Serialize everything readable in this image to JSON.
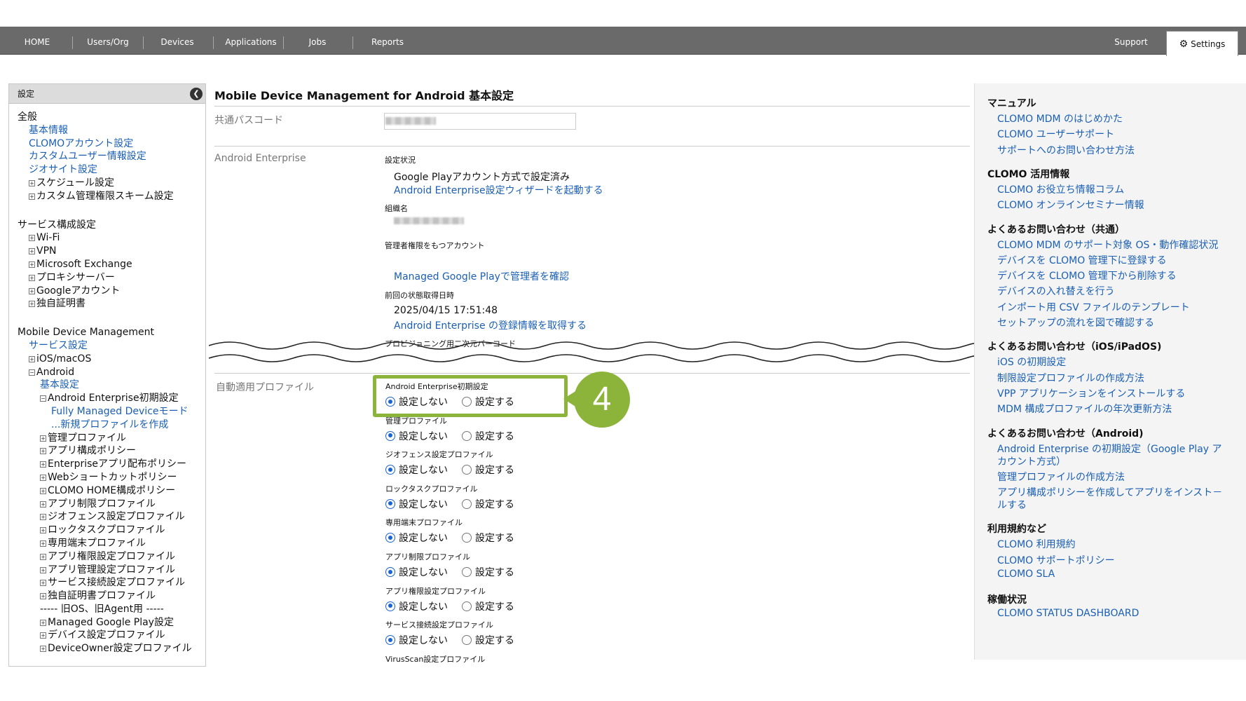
{
  "nav": {
    "items": [
      "HOME",
      "Users/Org",
      "Devices",
      "Applications",
      "Jobs",
      "Reports"
    ],
    "support": "Support",
    "settings": "Settings"
  },
  "sidebar": {
    "title": "設定",
    "rows": [
      {
        "text": "全般",
        "kind": "h"
      },
      {
        "text": "基本情報",
        "kind": "l2link"
      },
      {
        "text": "CLOMOアカウント設定",
        "kind": "l2link"
      },
      {
        "text": "カスタムユーザー情報設定",
        "kind": "l2link"
      },
      {
        "text": "ジオサイト設定",
        "kind": "l2link"
      },
      {
        "text": "スケジュール設定",
        "kind": "l2plus"
      },
      {
        "text": "カスタム管理権限スキーム設定",
        "kind": "l2plus"
      },
      {
        "text": "",
        "kind": "gap"
      },
      {
        "text": "サービス構成設定",
        "kind": "h"
      },
      {
        "text": "Wi-Fi",
        "kind": "l2plus"
      },
      {
        "text": "VPN",
        "kind": "l2plus"
      },
      {
        "text": "Microsoft Exchange",
        "kind": "l2plus"
      },
      {
        "text": "プロキシサーバー",
        "kind": "l2plus"
      },
      {
        "text": "Googleアカウント",
        "kind": "l2plus"
      },
      {
        "text": "独自証明書",
        "kind": "l2plus"
      },
      {
        "text": "",
        "kind": "gap"
      },
      {
        "text": "Mobile Device Management",
        "kind": "h"
      },
      {
        "text": "サービス設定",
        "kind": "l2link"
      },
      {
        "text": "iOS/macOS",
        "kind": "l2plus"
      },
      {
        "text": "Android",
        "kind": "l2minus"
      },
      {
        "text": "基本設定",
        "kind": "l3link"
      },
      {
        "text": "Android Enterprise初期設定",
        "kind": "l3minus"
      },
      {
        "text": "Fully Managed Deviceモード",
        "kind": "l4link"
      },
      {
        "text": "...新規プロファイルを作成",
        "kind": "l4link"
      },
      {
        "text": "管理プロファイル",
        "kind": "l3plus"
      },
      {
        "text": "アプリ構成ポリシー",
        "kind": "l3plus"
      },
      {
        "text": "Enterpriseアプリ配布ポリシー",
        "kind": "l3plus"
      },
      {
        "text": "Webショートカットポリシー",
        "kind": "l3plus"
      },
      {
        "text": "CLOMO HOME構成ポリシー",
        "kind": "l3plus"
      },
      {
        "text": "アプリ制限プロファイル",
        "kind": "l3plus"
      },
      {
        "text": "ジオフェンス設定プロファイル",
        "kind": "l3plus"
      },
      {
        "text": "ロックタスクプロファイル",
        "kind": "l3plus"
      },
      {
        "text": "専用端末プロファイル",
        "kind": "l3plus"
      },
      {
        "text": "アプリ権限設定プロファイル",
        "kind": "l3plus"
      },
      {
        "text": "アプリ管理設定プロファイル",
        "kind": "l3plus"
      },
      {
        "text": "サービス接続設定プロファイル",
        "kind": "l3plus"
      },
      {
        "text": "独自証明書プロファイル",
        "kind": "l3plus"
      },
      {
        "text": "----- 旧OS、旧Agent用 -----",
        "kind": "l3text"
      },
      {
        "text": "Managed Google Play設定",
        "kind": "l3plus"
      },
      {
        "text": "デバイス設定プロファイル",
        "kind": "l3plus"
      },
      {
        "text": "DeviceOwner設定プロファイル",
        "kind": "l3plus"
      }
    ]
  },
  "main": {
    "title": "Mobile Device Management for Android 基本設定",
    "passcode_label": "共通パスコード",
    "ae_label": "Android Enterprise",
    "status_label": "設定状況",
    "status_value": "Google Playアカウント方式で設定済み",
    "wizard_link": "Android Enterprise設定ウィザードを起動する",
    "org_label": "組織名",
    "admin_label": "管理者権限をもつアカウント",
    "admin_link": "Managed Google Playで管理者を確認",
    "last_label": "前回の状態取得日時",
    "last_value": "2025/04/15 17:51:48",
    "refresh_link": "Android Enterprise の登録情報を取得する",
    "qr_label": "プロビジョニング用二次元バーコード",
    "auto_label": "自動適用プロファイル",
    "radio_off": "設定しない",
    "radio_on": "設定する",
    "profiles": [
      "Android Enterprise初期設定",
      "管理プロファイル",
      "ジオフェンス設定プロファイル",
      "ロックタスクプロファイル",
      "専用端末プロファイル",
      "アプリ制限プロファイル",
      "アプリ権限設定プロファイル",
      "サービス接続設定プロファイル",
      "VirusScan設定プロファイル"
    ],
    "step_number": "4",
    "accent_color": "#8db43a"
  },
  "rightpanel": {
    "sections": [
      {
        "heading": "マニュアル",
        "links": [
          "CLOMO MDM のはじめかた",
          "CLOMO ユーザーサポート",
          "サポートへのお問い合わせ方法"
        ]
      },
      {
        "heading": "CLOMO 活用情報",
        "links": [
          "CLOMO お役立ち情報コラム",
          "CLOMO オンラインセミナー情報"
        ]
      },
      {
        "heading": "よくあるお問い合わせ（共通）",
        "links": [
          "CLOMO MDM のサポート対象 OS・動作確認状況",
          "デバイスを CLOMO 管理下に登録する",
          "デバイスを CLOMO 管理下から削除する",
          "デバイスの入れ替えを行う",
          "インポート用 CSV ファイルのテンプレート",
          "セットアップの流れを図で確認する"
        ]
      },
      {
        "heading": "よくあるお問い合わせ（iOS/iPadOS)",
        "links": [
          "iOS の初期設定",
          "制限設定プロファイルの作成方法",
          "VPP アプリケーションをインストールする",
          "MDM 構成プロファイルの年次更新方法"
        ]
      },
      {
        "heading": "よくあるお問い合わせ（Android)",
        "links": [
          "Android Enterprise の初期設定（Google Play ア",
          "カウント方式）",
          "管理プロファイルの作成方法",
          "アプリ構成ポリシーを作成してアプリをインスト－",
          "ルする"
        ]
      },
      {
        "heading": "利用規約など",
        "links": [
          "CLOMO 利用規約",
          "CLOMO サポートポリシー",
          "CLOMO SLA"
        ]
      },
      {
        "heading": "稼働状況",
        "links": [
          "CLOMO STATUS DASHBOARD"
        ]
      }
    ]
  }
}
